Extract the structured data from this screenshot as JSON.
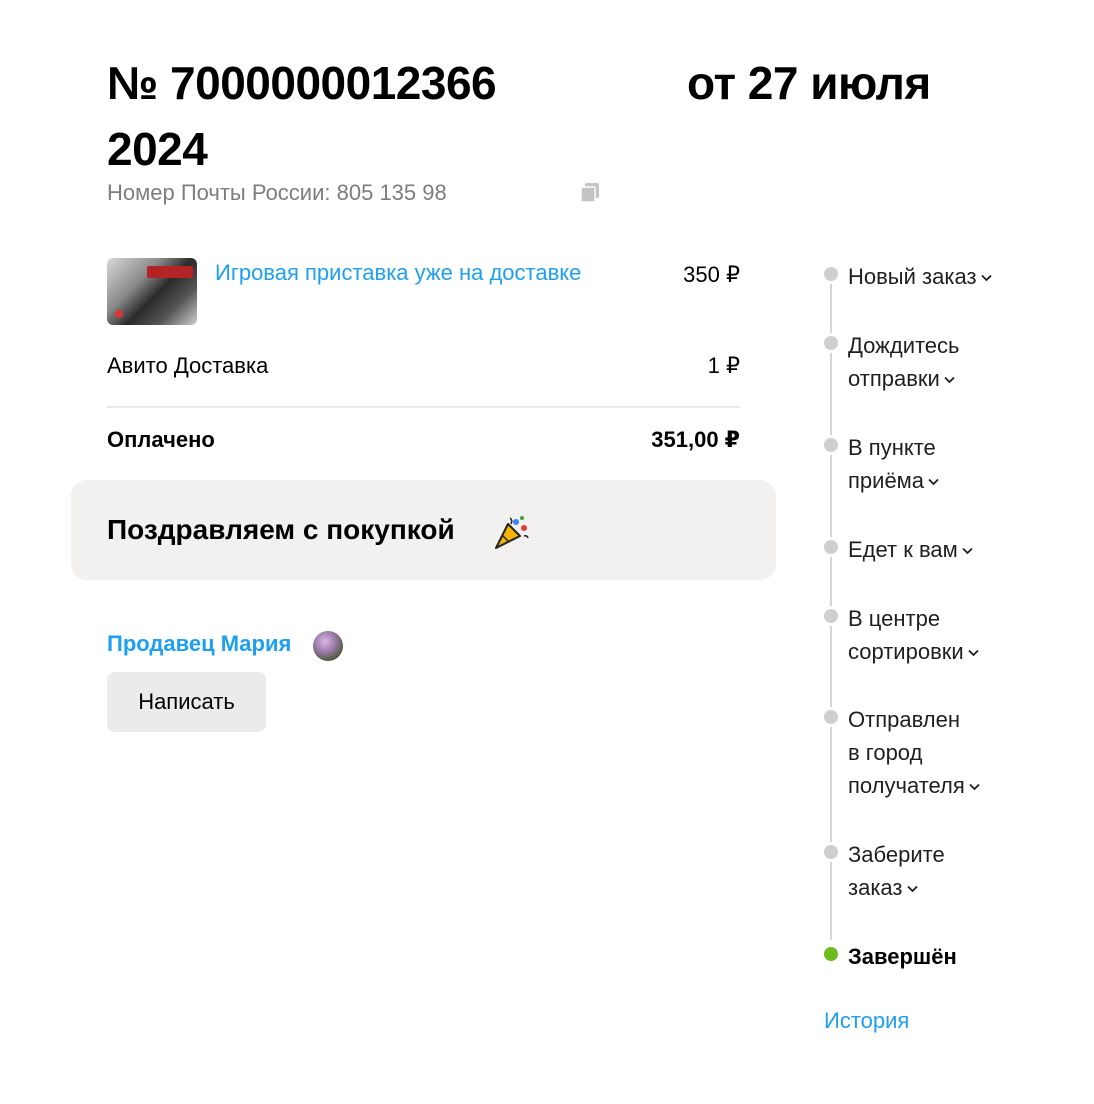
{
  "order": {
    "number_prefix": "№ 7000000012366",
    "date_text": "от 27 июля",
    "year": "2024",
    "tracking_label": "Номер Почты России:",
    "tracking_value": "805 135 98"
  },
  "items": [
    {
      "title": "Игровая приставка уже на доставке",
      "price": "350 ₽"
    }
  ],
  "delivery": {
    "label": "Авито Доставка",
    "price": "1 ₽"
  },
  "paid": {
    "label": "Оплачено",
    "amount": "351,00 ₽"
  },
  "congrats": {
    "text": "Поздравляем с покупкой"
  },
  "seller": {
    "label": "Продавец Мария",
    "write_button": "Написать"
  },
  "statuses": [
    {
      "label": "Новый заказ",
      "expandable": true,
      "state": "pending"
    },
    {
      "label": "Дождитесь\nотправки",
      "expandable": true,
      "state": "pending"
    },
    {
      "label": "В пункте\nприёма",
      "expandable": true,
      "state": "pending"
    },
    {
      "label": "Едет к вам",
      "expandable": true,
      "state": "pending"
    },
    {
      "label": "В центре\nсортировки",
      "expandable": true,
      "state": "pending"
    },
    {
      "label": "Отправлен\nв город\nполучателя",
      "expandable": true,
      "state": "pending"
    },
    {
      "label": "Заберите\nзаказ",
      "expandable": true,
      "state": "pending"
    },
    {
      "label": "Завершён",
      "expandable": false,
      "state": "done"
    }
  ],
  "history_link": "История",
  "icons": {
    "copy": "copy-icon",
    "party": "party-popper-icon",
    "chevron": "chevron-down-icon"
  },
  "colors": {
    "link": "#1ea0f2",
    "done": "#6dbb1e",
    "pending": "#cfcfcf",
    "card_bg": "#f2f1f0",
    "button_bg": "#ebebeb"
  }
}
